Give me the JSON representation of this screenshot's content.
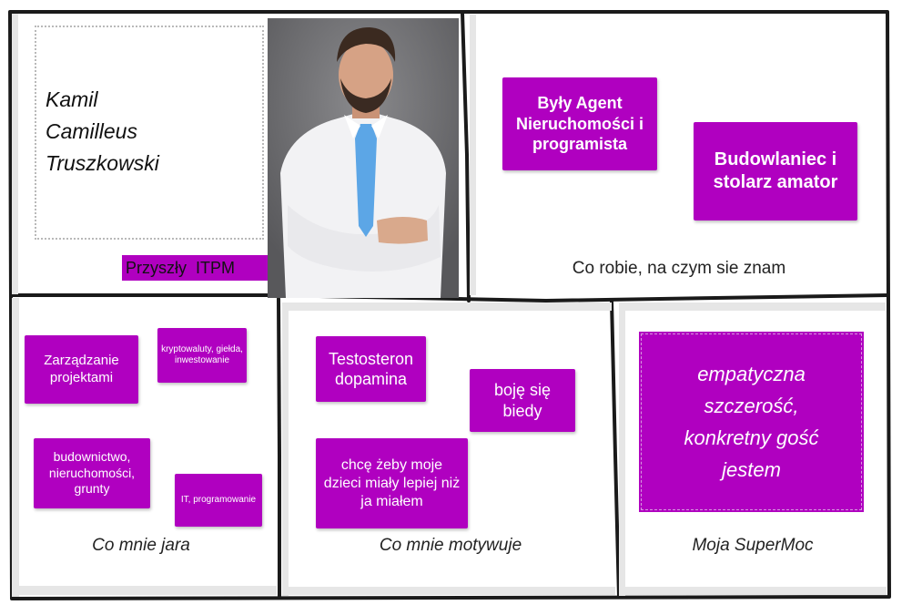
{
  "profile": {
    "name": "Kamil\nCamilleus\nTruszkowski",
    "title_tag": "Przyszły  ITPM"
  },
  "section_top_right": {
    "caption": "Co robie, na czym sie znam",
    "notes": [
      "Były Agent Nieruchomości i programista",
      "Budowlaniec i stolarz amator"
    ]
  },
  "section_passions": {
    "caption": "Co mnie jara",
    "notes": [
      "Zarządzanie projektami",
      "kryptowaluty, giełda, inwestowanie",
      "budownictwo, nieruchomości, grunty",
      "IT, programowanie"
    ]
  },
  "section_motivation": {
    "caption": "Co mnie motywuje",
    "notes": [
      "Testosteron dopamina",
      "boję się biedy",
      "chcę żeby moje dzieci miały lepiej niż ja miałem"
    ]
  },
  "section_supermoc": {
    "caption": "Moja SuperMoc",
    "note": "empatyczna\nszczerość,\nkonkretny gość\njestem"
  },
  "colors": {
    "sticky_note": "#b000c0",
    "frame": "#1a1a1a"
  }
}
